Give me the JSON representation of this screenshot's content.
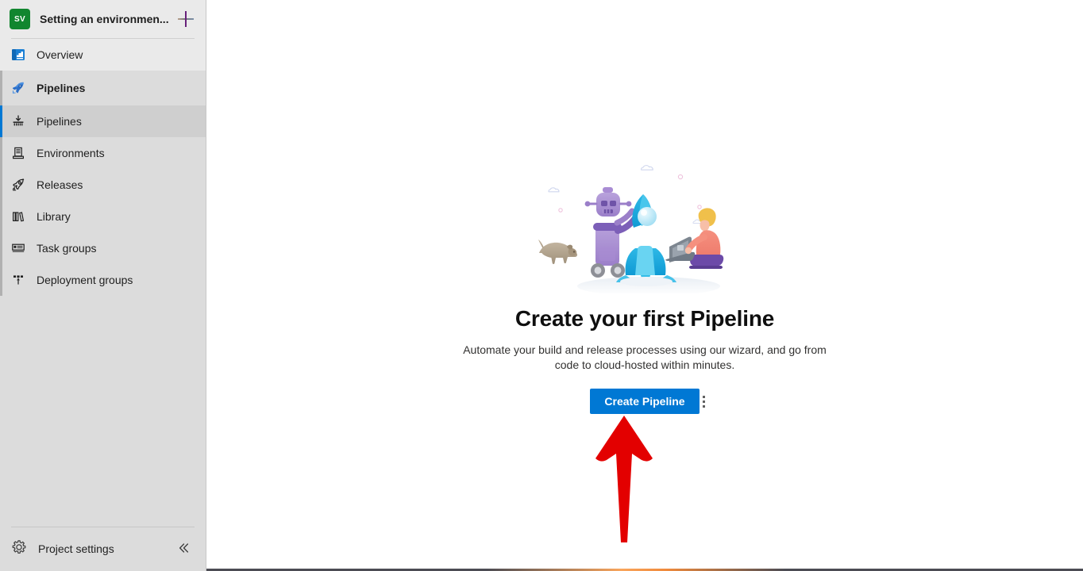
{
  "sidebar": {
    "project": {
      "avatar_initials": "SV",
      "title": "Setting an environmen...",
      "new_label": "plus-icon"
    },
    "overview": {
      "label": "Overview",
      "icon": "overview-icon"
    },
    "group": {
      "label": "Pipelines",
      "icon": "pipelines-rocket-icon"
    },
    "items": [
      {
        "label": "Pipelines",
        "icon": "pipelines-icon",
        "selected": true
      },
      {
        "label": "Environments",
        "icon": "environments-icon",
        "selected": false
      },
      {
        "label": "Releases",
        "icon": "releases-rocket-icon",
        "selected": false
      },
      {
        "label": "Library",
        "icon": "library-icon",
        "selected": false
      },
      {
        "label": "Task groups",
        "icon": "task-groups-icon",
        "selected": false
      },
      {
        "label": "Deployment groups",
        "icon": "deployment-groups-icon",
        "selected": false
      }
    ],
    "footer": {
      "settings_label": "Project settings",
      "settings_icon": "gear-icon",
      "collapse_icon": "chevron-double-left-icon"
    }
  },
  "main": {
    "illustration": "robot-rocket-developer-illustration",
    "title": "Create your first Pipeline",
    "subtitle": "Automate your build and release processes using our wizard, and go from code to cloud-hosted within minutes.",
    "create_button": "Create Pipeline",
    "more_actions_icon": "more-vertical-icon",
    "annotation_arrow": "red-arrow-pointing-up"
  },
  "colors": {
    "accent": "#0078d4",
    "project_avatar": "#11862f",
    "sidebar_top": "#eaeaea",
    "sidebar_group": "#dcdcdc",
    "sidebar_selected": "#cfcfcf",
    "annotation": "#e30000",
    "progress_glow": "#f08a3c"
  }
}
